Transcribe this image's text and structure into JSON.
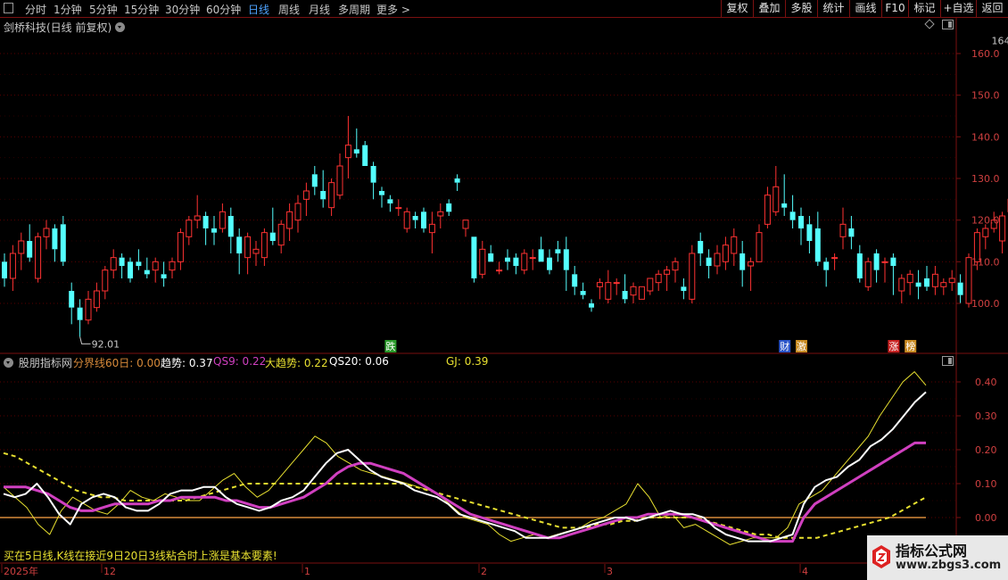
{
  "toolbar": {
    "periods": [
      "分时",
      "1分钟",
      "5分钟",
      "15分钟",
      "30分钟",
      "60分钟",
      "日线",
      "周线",
      "月线",
      "多周期",
      "更多 >"
    ],
    "active_period": "日线",
    "right_buttons": [
      "复权",
      "叠加",
      "多股",
      "统计",
      "画线",
      "F10",
      "标记",
      "+自选",
      "返回"
    ]
  },
  "main_chart": {
    "title": "剑桥科技(日线 前复权)",
    "high_label": "164.30",
    "low_label": "92.01",
    "y_ticks": [
      "160.0",
      "150.0",
      "140.0",
      "130.0",
      "120.0",
      "110.0",
      "100.0"
    ],
    "markers": [
      {
        "text": "跌",
        "color": "#2a9a2a"
      },
      {
        "text": "财",
        "color": "#2a54c8"
      },
      {
        "text": "激",
        "color": "#c88a20"
      },
      {
        "text": "涨",
        "color": "#c82020"
      },
      {
        "text": "榜",
        "color": "#c88a20"
      }
    ]
  },
  "indicator": {
    "name": "股朋指标网",
    "items": [
      {
        "label": "分界线60日: 0.00",
        "color": "#d88a3a"
      },
      {
        "label": "趋势: 0.37",
        "color": "#ffffff"
      },
      {
        "label": "QS9: 0.22",
        "color": "#d040c0"
      },
      {
        "label": "大趋势: 0.22",
        "color": "#e8e030"
      },
      {
        "label": "QS20: 0.06",
        "color": "#ffffff"
      },
      {
        "label": "GJ: 0.39",
        "color": "#e8e030"
      }
    ],
    "y_ticks": [
      "0.40",
      "0.30",
      "0.20",
      "0.10",
      "0.00"
    ],
    "note": "买在5日线,K线在接近9日20日3线粘合时上涨是基本要素!"
  },
  "x_axis": [
    "2025年",
    "12",
    "1",
    "2",
    "3",
    "4"
  ],
  "watermark": {
    "title": "指标公式网",
    "url": "www.zbgs3.com"
  },
  "colors": {
    "up": "#ff3232",
    "down": "#54ffff",
    "grid": "#5a0000",
    "frame": "#7a1010"
  },
  "chart_data": [
    {
      "type": "candlestick",
      "title": "剑桥科技(日线 前复权)",
      "y_range": [
        92,
        165
      ],
      "high": 164.3,
      "low": 92.01,
      "ohlc": [
        [
          110,
          112,
          104,
          106
        ],
        [
          106,
          114,
          103,
          112
        ],
        [
          112,
          117,
          108,
          115
        ],
        [
          115,
          119,
          110,
          111
        ],
        [
          106,
          117,
          105,
          116
        ],
        [
          116,
          120,
          113,
          118
        ],
        [
          118,
          119,
          110,
          113
        ],
        [
          119,
          121,
          109,
          110
        ],
        [
          103,
          105,
          95,
          99
        ],
        [
          99,
          101,
          92,
          96
        ],
        [
          96,
          103,
          95,
          101
        ],
        [
          99,
          105,
          98,
          103
        ],
        [
          103,
          109,
          101,
          108
        ],
        [
          108,
          113,
          106,
          111
        ],
        [
          111,
          112,
          106,
          109
        ],
        [
          110,
          111,
          105,
          106
        ],
        [
          110,
          113,
          108,
          109
        ],
        [
          108,
          111,
          106,
          107
        ],
        [
          108,
          111,
          105,
          110
        ],
        [
          107,
          110,
          104,
          106
        ],
        [
          108,
          111,
          106,
          110
        ],
        [
          110,
          118,
          108,
          117
        ],
        [
          116,
          121,
          114,
          120
        ],
        [
          120,
          126,
          118,
          121
        ],
        [
          121,
          122,
          114,
          118
        ],
        [
          118,
          121,
          114,
          117
        ],
        [
          118,
          124,
          117,
          122
        ],
        [
          121,
          123,
          112,
          116
        ],
        [
          116,
          118,
          107,
          112
        ],
        [
          111,
          117,
          107,
          116
        ],
        [
          112,
          115,
          109,
          113
        ],
        [
          111,
          118,
          109,
          117
        ],
        [
          117,
          123,
          114,
          115
        ],
        [
          114,
          120,
          112,
          119
        ],
        [
          118,
          124,
          115,
          122
        ],
        [
          120,
          126,
          117,
          124
        ],
        [
          125,
          129,
          121,
          127
        ],
        [
          131,
          133,
          126,
          128
        ],
        [
          127,
          132,
          123,
          125
        ],
        [
          123,
          130,
          121,
          129
        ],
        [
          126,
          136,
          125,
          133
        ],
        [
          135,
          145,
          130,
          138
        ],
        [
          137,
          142,
          135,
          136
        ],
        [
          138,
          139,
          133,
          133
        ],
        [
          133,
          134,
          125,
          129
        ],
        [
          127,
          128,
          123,
          126
        ],
        [
          125,
          126,
          122,
          124
        ],
        [
          123,
          125,
          121,
          123
        ],
        [
          118,
          123,
          117,
          122
        ],
        [
          121,
          122,
          118,
          120
        ],
        [
          122,
          123,
          117,
          118
        ],
        [
          117,
          122,
          112,
          119
        ],
        [
          121,
          124,
          118,
          122
        ],
        [
          124,
          125,
          121,
          122
        ],
        [
          130,
          131,
          127,
          129
        ],
        [
          118,
          120,
          116,
          120
        ],
        [
          116,
          116,
          105,
          106
        ],
        [
          107,
          115,
          106,
          113
        ],
        [
          112,
          114,
          110,
          110
        ],
        [
          108,
          110,
          107,
          108
        ],
        [
          111,
          113,
          108,
          110
        ],
        [
          111,
          112,
          107,
          109
        ],
        [
          108,
          113,
          107,
          112
        ],
        [
          111,
          113,
          108,
          111
        ],
        [
          113,
          116,
          110,
          110
        ],
        [
          111,
          113,
          107,
          108
        ],
        [
          113,
          115,
          110,
          112
        ],
        [
          113,
          116,
          103,
          108
        ],
        [
          107,
          109,
          102,
          104
        ],
        [
          103,
          105,
          101,
          102
        ],
        [
          100,
          101,
          98,
          99
        ],
        [
          104,
          106,
          101,
          105
        ],
        [
          101,
          108,
          100,
          105
        ],
        [
          105,
          106,
          102,
          105
        ],
        [
          103,
          107,
          100,
          101
        ],
        [
          102,
          105,
          100,
          104
        ],
        [
          101,
          104,
          101,
          104
        ],
        [
          103,
          105,
          102,
          106
        ],
        [
          105,
          108,
          103,
          107
        ],
        [
          107,
          109,
          103,
          108
        ],
        [
          108,
          111,
          105,
          110
        ],
        [
          104,
          106,
          101,
          103
        ],
        [
          101,
          114,
          100,
          112
        ],
        [
          115,
          117,
          109,
          112
        ],
        [
          111,
          113,
          106,
          109
        ],
        [
          109,
          114,
          107,
          112
        ],
        [
          110,
          116,
          108,
          114
        ],
        [
          112,
          118,
          109,
          116
        ],
        [
          112,
          115,
          104,
          108
        ],
        [
          109,
          111,
          103,
          110
        ],
        [
          110,
          119,
          110,
          117
        ],
        [
          119,
          128,
          118,
          126
        ],
        [
          122,
          133,
          121,
          128
        ],
        [
          124,
          131,
          121,
          123
        ],
        [
          122,
          126,
          118,
          120
        ],
        [
          121,
          123,
          114,
          118
        ],
        [
          119,
          121,
          112,
          115
        ],
        [
          118,
          122,
          109,
          110
        ],
        [
          110,
          111,
          104,
          108
        ],
        [
          111,
          112,
          108,
          111
        ],
        [
          116,
          123,
          113,
          119
        ],
        [
          118,
          121,
          113,
          116
        ],
        [
          112,
          114,
          105,
          106
        ],
        [
          104,
          111,
          103,
          110
        ],
        [
          112,
          113,
          105,
          108
        ],
        [
          110,
          111,
          105,
          110
        ],
        [
          111,
          112,
          102,
          109
        ],
        [
          103,
          107,
          100,
          106
        ],
        [
          105,
          108,
          102,
          107
        ],
        [
          105,
          108,
          101,
          104
        ],
        [
          106,
          109,
          103,
          104
        ],
        [
          104,
          109,
          102,
          107
        ],
        [
          104,
          106,
          102,
          105
        ],
        [
          105,
          108,
          103,
          106
        ],
        [
          105,
          107,
          100,
          102
        ],
        [
          100,
          112,
          99,
          111
        ],
        [
          110,
          118,
          108,
          117
        ],
        [
          116,
          119,
          113,
          118
        ],
        [
          118,
          122,
          117,
          120
        ],
        [
          115,
          122,
          112,
          121
        ],
        [
          122,
          129,
          120,
          125
        ],
        [
          126,
          133,
          122,
          127
        ],
        [
          126,
          134,
          125,
          133
        ],
        [
          131,
          143,
          130,
          144
        ],
        [
          150,
          161,
          148,
          160
        ],
        [
          153,
          164,
          150,
          161
        ],
        [
          157,
          164,
          155,
          157
        ]
      ]
    },
    {
      "type": "line",
      "title": "股朋指标网",
      "y_range": [
        -0.1,
        0.44
      ],
      "series": [
        {
          "name": "趋势",
          "color": "#ffffff",
          "values": [
            0.07,
            0.06,
            0.07,
            0.1,
            0.06,
            0.01,
            -0.02,
            0.04,
            0.06,
            0.07,
            0.06,
            0.03,
            0.02,
            0.02,
            0.04,
            0.07,
            0.08,
            0.08,
            0.09,
            0.09,
            0.06,
            0.04,
            0.03,
            0.02,
            0.03,
            0.05,
            0.06,
            0.08,
            0.12,
            0.16,
            0.19,
            0.2,
            0.17,
            0.14,
            0.12,
            0.11,
            0.1,
            0.08,
            0.07,
            0.06,
            0.04,
            0.01,
            0.0,
            -0.01,
            -0.02,
            -0.03,
            -0.04,
            -0.06,
            -0.06,
            -0.06,
            -0.05,
            -0.04,
            -0.03,
            -0.02,
            -0.01,
            0.0,
            0.0,
            -0.01,
            0.0,
            0.01,
            0.02,
            0.01,
            0.01,
            0.0,
            -0.03,
            -0.05,
            -0.06,
            -0.07,
            -0.07,
            -0.07,
            -0.06,
            -0.05,
            0.04,
            0.09,
            0.11,
            0.12,
            0.15,
            0.17,
            0.21,
            0.23,
            0.26,
            0.3,
            0.34,
            0.37
          ]
        },
        {
          "name": "QS9",
          "color": "#d040c0",
          "values": [
            0.09,
            0.09,
            0.09,
            0.08,
            0.07,
            0.05,
            0.03,
            0.02,
            0.02,
            0.03,
            0.04,
            0.04,
            0.04,
            0.04,
            0.05,
            0.05,
            0.06,
            0.06,
            0.06,
            0.06,
            0.05,
            0.05,
            0.04,
            0.03,
            0.03,
            0.04,
            0.05,
            0.06,
            0.08,
            0.1,
            0.13,
            0.15,
            0.16,
            0.16,
            0.15,
            0.14,
            0.13,
            0.11,
            0.09,
            0.07,
            0.05,
            0.03,
            0.01,
            0.0,
            -0.01,
            -0.02,
            -0.03,
            -0.04,
            -0.05,
            -0.06,
            -0.06,
            -0.05,
            -0.04,
            -0.03,
            -0.02,
            -0.01,
            0.0,
            0.0,
            0.01,
            0.01,
            0.01,
            0.01,
            0.0,
            -0.01,
            -0.02,
            -0.03,
            -0.04,
            -0.05,
            -0.06,
            -0.07,
            -0.07,
            -0.07,
            0.0,
            0.04,
            0.06,
            0.08,
            0.1,
            0.12,
            0.14,
            0.16,
            0.18,
            0.2,
            0.22,
            0.22
          ]
        },
        {
          "name": "大趋势",
          "color": "#e8e030",
          "values": [
            0.19,
            0.18,
            0.16,
            0.14,
            0.12,
            0.1,
            0.08,
            0.07,
            0.06,
            0.06,
            0.05,
            0.05,
            0.05,
            0.05,
            0.05,
            0.05,
            0.06,
            0.07,
            0.08,
            0.09,
            0.1,
            0.1,
            0.1,
            0.1,
            0.1,
            0.1,
            0.1,
            0.1,
            0.1,
            0.1,
            0.1,
            0.1,
            0.1,
            0.1,
            0.09,
            0.08,
            0.07,
            0.06,
            0.05,
            0.04,
            0.03,
            0.02,
            0.01,
            0.0,
            -0.01,
            -0.02,
            -0.03,
            -0.03,
            -0.03,
            -0.02,
            -0.02,
            -0.01,
            -0.01,
            0.0,
            0.0,
            0.0,
            0.0,
            0.0,
            -0.01,
            -0.02,
            -0.03,
            -0.04,
            -0.05,
            -0.05,
            -0.06,
            -0.06,
            -0.06,
            -0.06,
            -0.05,
            -0.04,
            -0.03,
            -0.02,
            -0.01,
            0.0,
            0.02,
            0.04,
            0.06
          ]
        },
        {
          "name": "GJ",
          "color": "#e8e030",
          "values": [
            0.09,
            0.06,
            0.03,
            -0.02,
            -0.05,
            0.02,
            0.06,
            0.04,
            0.02,
            0.01,
            0.04,
            0.08,
            0.06,
            0.05,
            0.07,
            0.06,
            0.05,
            0.05,
            0.08,
            0.11,
            0.13,
            0.09,
            0.06,
            0.08,
            0.12,
            0.16,
            0.2,
            0.24,
            0.22,
            0.18,
            0.16,
            0.14,
            0.13,
            0.12,
            0.11,
            0.1,
            0.09,
            0.08,
            0.06,
            0.03,
            0.0,
            -0.01,
            -0.02,
            -0.05,
            -0.07,
            -0.06,
            -0.05,
            -0.06,
            -0.05,
            -0.04,
            -0.03,
            -0.01,
            0.0,
            0.02,
            0.04,
            0.1,
            0.06,
            0.0,
            0.01,
            -0.03,
            -0.02,
            -0.04,
            -0.06,
            -0.08,
            -0.07,
            -0.06,
            -0.06,
            -0.06,
            -0.03,
            0.04,
            0.06,
            0.08,
            0.12,
            0.16,
            0.2,
            0.24,
            0.3,
            0.35,
            0.4,
            0.43,
            0.39
          ]
        }
      ],
      "reference_line": {
        "name": "分界线60日",
        "value": 0.0,
        "color": "#d88a3a"
      }
    }
  ]
}
